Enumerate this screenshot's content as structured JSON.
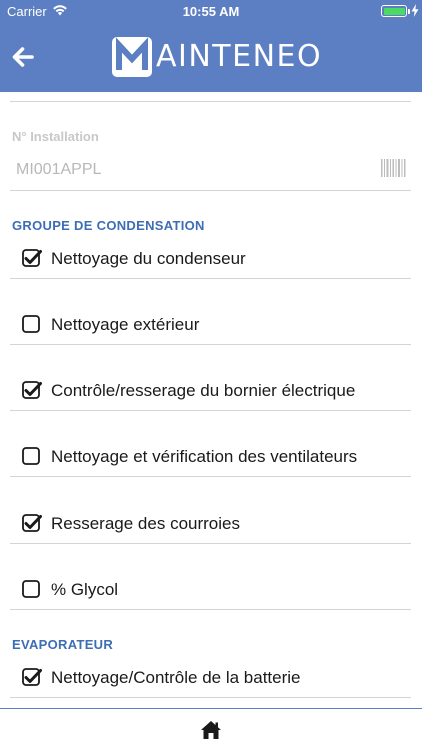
{
  "status_bar": {
    "carrier": "Carrier",
    "time": "10:55 AM"
  },
  "nav": {
    "logo_initial": "M",
    "logo_text": "AINTENEO"
  },
  "installation": {
    "label": "N° Installation",
    "value": "MI001APPL"
  },
  "sections": [
    {
      "title": "GROUPE DE CONDENSATION",
      "items": [
        {
          "label": "Nettoyage du condenseur",
          "checked": true
        },
        {
          "label": "Nettoyage extérieur",
          "checked": false
        },
        {
          "label": "Contrôle/resserage du bornier électrique",
          "checked": true
        },
        {
          "label": "Nettoyage et vérification des ventilateurs",
          "checked": false
        },
        {
          "label": "Resserage des courroies",
          "checked": true
        },
        {
          "label": "% Glycol",
          "checked": false
        }
      ]
    },
    {
      "title": "EVAPORATEUR",
      "items": [
        {
          "label": "Nettoyage/Contrôle de la batterie",
          "checked": true
        }
      ]
    }
  ],
  "colors": {
    "brand": "#5b7fc2",
    "section_title": "#3d6db5",
    "battery": "#4cd964"
  },
  "icons": {
    "back": "arrow-left-icon",
    "scan": "barcode-icon",
    "home": "home-icon"
  }
}
